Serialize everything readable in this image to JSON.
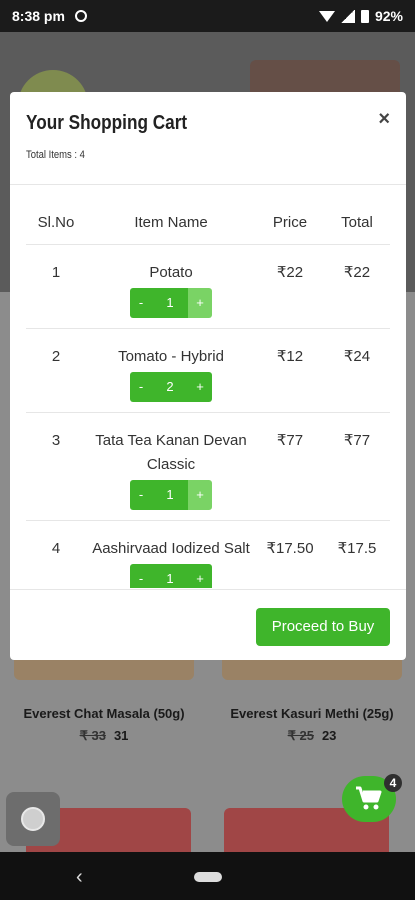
{
  "status_bar": {
    "time": "8:38 pm",
    "battery": "92%"
  },
  "cart": {
    "title": "Your Shopping Cart",
    "total_items": "Total Items : 4",
    "close_label": "×",
    "columns": [
      "Sl.No",
      "Item Name",
      "Price",
      "Total"
    ],
    "items": [
      {
        "sl": "1",
        "name": "Potato",
        "price": "₹22",
        "total": "₹22",
        "qty": "1",
        "minus": "-",
        "plus": "+"
      },
      {
        "sl": "2",
        "name": "Tomato - Hybrid",
        "price": "₹12",
        "total": "₹24",
        "qty": "2",
        "minus": "-",
        "plus": "+"
      },
      {
        "sl": "3",
        "name": "Tata Tea Kanan Devan Classic",
        "price": "₹77",
        "total": "₹77",
        "qty": "1",
        "minus": "-",
        "plus": "+"
      },
      {
        "sl": "4",
        "name": "Aashirvaad Iodized Salt",
        "price": "₹17.50",
        "total": "₹17.5",
        "qty": "1",
        "minus": "-",
        "plus": "+"
      }
    ],
    "proceed_label": "Proceed to Buy"
  },
  "background": {
    "products": [
      {
        "name": "Everest Chat Masala (50g)",
        "old_price": "₹ 33",
        "price": "31"
      },
      {
        "name": "Everest Kasuri Methi (25g)",
        "old_price": "₹ 25",
        "price": "23"
      }
    ]
  },
  "cart_fab": {
    "count": "4",
    "icon": "cart-icon"
  },
  "colors": {
    "accent": "#3fb52b",
    "accent_light": "#7ad365"
  }
}
